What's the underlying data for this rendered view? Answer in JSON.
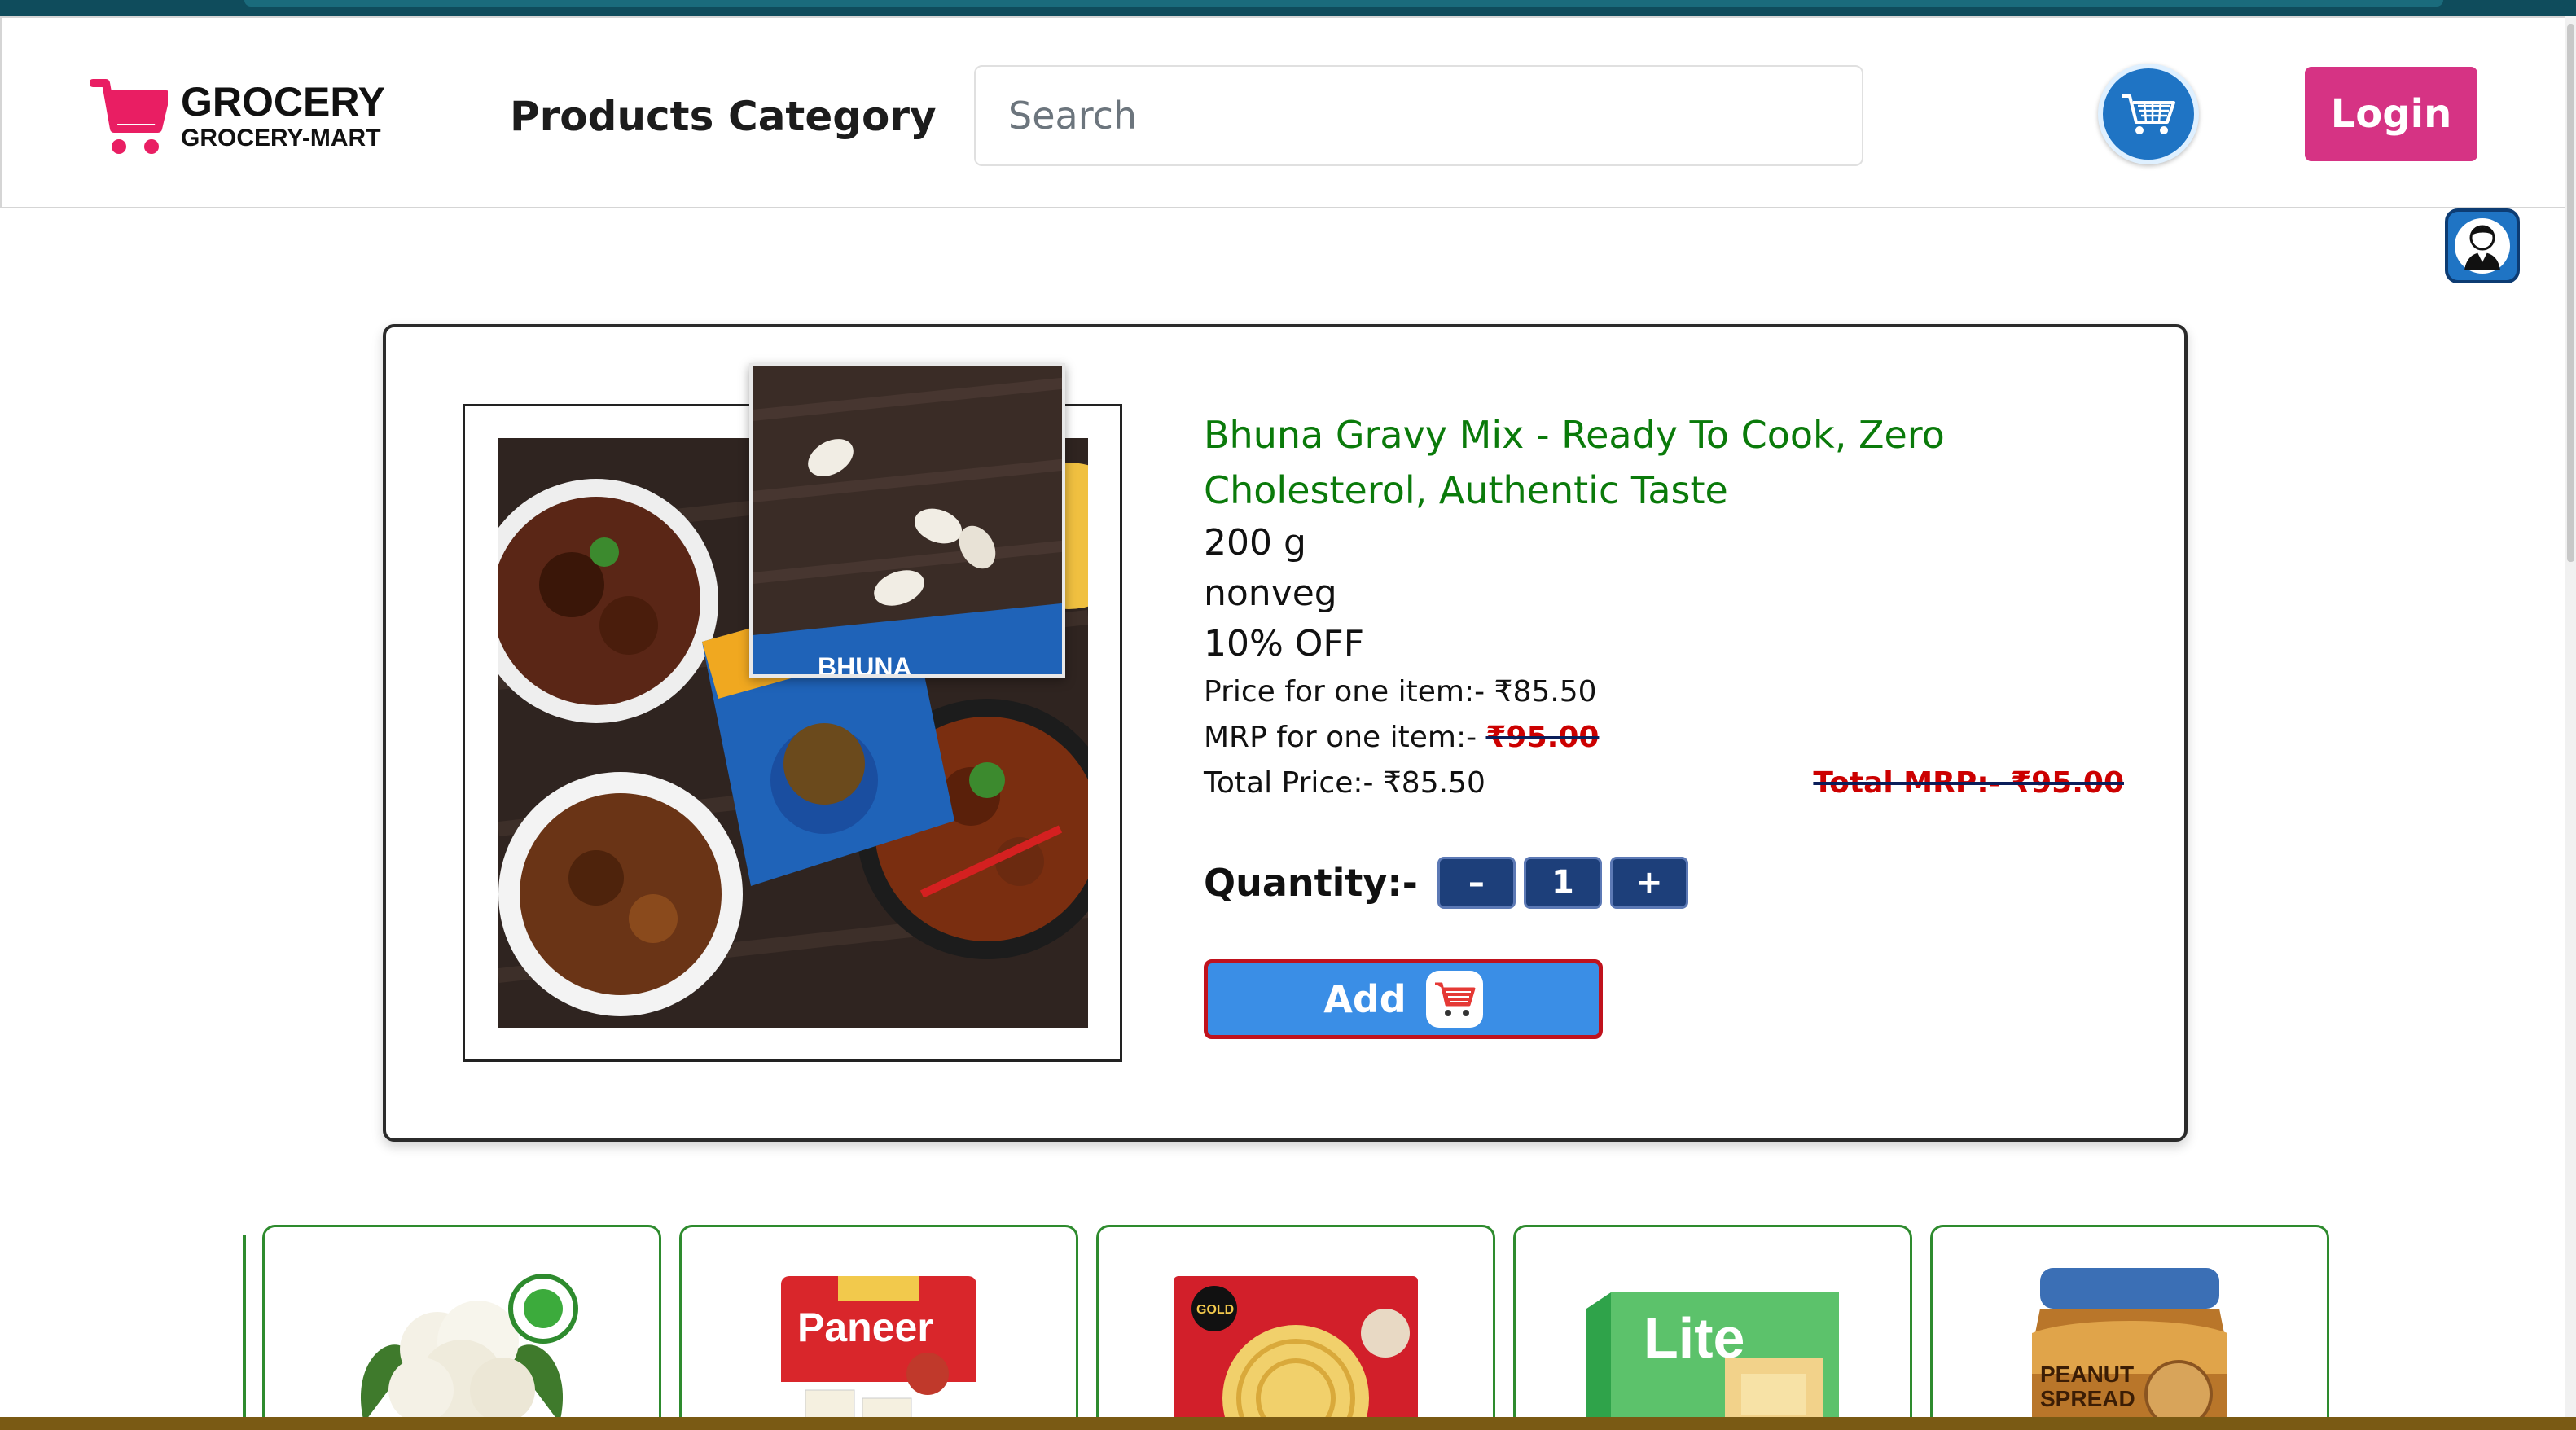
{
  "brand": {
    "title": "GROCERY",
    "subtitle": "GROCERY-MART"
  },
  "nav": {
    "products": "Products",
    "category": "Category"
  },
  "search": {
    "placeholder": "Search",
    "value": ""
  },
  "header": {
    "login_label": "Login"
  },
  "product": {
    "name": "Bhuna Gravy Mix - Ready To Cook, Zero Cholesterol, Authentic Taste",
    "weight": "200 g",
    "type": "nonveg",
    "discount": "10% OFF",
    "price_label": "Price for one item:- ",
    "price_value": "₹85.50",
    "mrp_label": "MRP for one item:- ",
    "mrp_value": "₹95.00",
    "total_price": "Total Price:- ₹85.50",
    "total_mrp": "Total MRP:- ₹95.00",
    "quantity_label": "Quantity:-",
    "quantity": "1",
    "minus": "–",
    "plus": "+",
    "add_label": "Add"
  },
  "colors": {
    "brand_pink": "#d63384",
    "product_name_green": "#0a7a0a",
    "cart_blue": "#1f74c4",
    "qty_navy": "#1d3f7a",
    "add_blue": "#3a8ee6",
    "add_border_red": "#c0121d",
    "card_border_green": "#2e8b2e"
  },
  "related_products": [
    {
      "icon": "cauliflower-icon"
    },
    {
      "icon": "paneer-pack-icon"
    },
    {
      "icon": "paratha-pack-icon"
    },
    {
      "icon": "lite-spread-icon"
    },
    {
      "icon": "peanut-spread-icon"
    }
  ]
}
